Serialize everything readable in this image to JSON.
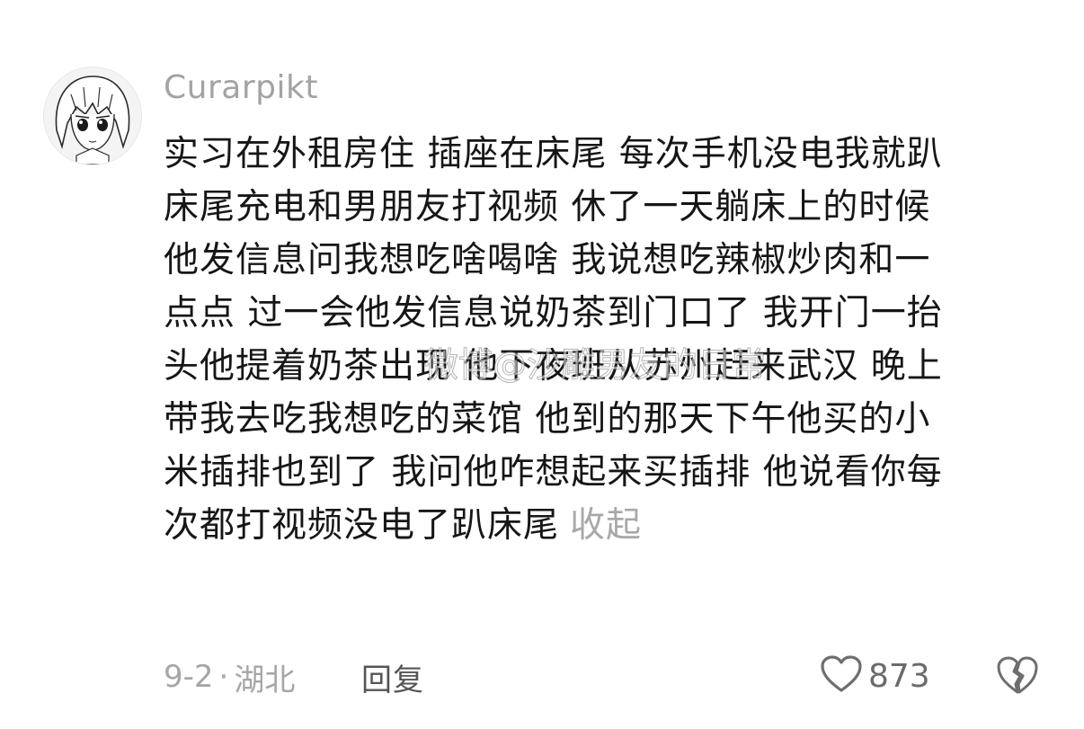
{
  "comment": {
    "username": "Curarpikt",
    "lines": [
      "实习在外租房住 插座在床尾 每次手机没电我就趴",
      "床尾充电和男朋友打视频 休了一天躺床上的时候",
      "他发信息问我想吃啥喝啥 我说想吃辣椒炒肉和一",
      "点点 过一会他发信息说奶茶到门口了 我开门一抬",
      "头他提着奶茶出现 他下夜班从苏州赶来武汉 晚上",
      "带我去吃我想吃的菜馆 他到的那天下午他买的小",
      "米插排也到了 我问他咋想起来买插排 他说看你每",
      "次都打视频没电了趴床尾"
    ],
    "collapse_label": "收起",
    "watermark": "微博@沙雕男友的日常",
    "date": "9-2",
    "separator": "·",
    "location": "湖北",
    "reply_label": "回复",
    "like_count": "873",
    "icons": {
      "avatar": "anime-girl-avatar",
      "like": "heart-outline-icon",
      "dislike": "broken-heart-icon"
    }
  }
}
